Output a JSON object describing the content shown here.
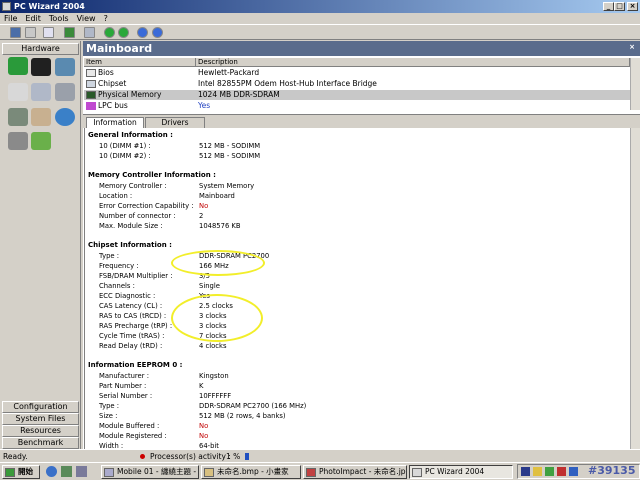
{
  "window": {
    "title": "PC Wizard 2004"
  },
  "menu": [
    "File",
    "Edit",
    "Tools",
    "View",
    "?"
  ],
  "sidebar": {
    "hardware_label": "Hardware",
    "bottom_items": [
      "Configuration",
      "System Files",
      "Resources",
      "Benchmark"
    ]
  },
  "mainboard": {
    "header": "Mainboard",
    "columns": [
      "Item",
      "Description"
    ],
    "rows": [
      {
        "item": "Bios",
        "desc": "Hewlett-Packard"
      },
      {
        "item": "Chipset",
        "desc": "Intel 82855PM Odem Host-Hub Interface Bridge"
      },
      {
        "item": "Physical Memory",
        "desc": "1024 MB DDR-SDRAM"
      },
      {
        "item": "LPC bus",
        "desc": "Yes"
      }
    ]
  },
  "tabs": [
    "Information",
    "Drivers"
  ],
  "info": {
    "general_title": "General Information :",
    "general": [
      {
        "l": "10 (DIMM #1) :",
        "v": "512 MB - SODIMM"
      },
      {
        "l": "10 (DIMM #2) :",
        "v": "512 MB - SODIMM"
      }
    ],
    "memctrl_title": "Memory Controller Information :",
    "memctrl": [
      {
        "l": "Memory Controller :",
        "v": "System Memory"
      },
      {
        "l": "Location :",
        "v": "Mainboard"
      },
      {
        "l": "Error Correction Capability :",
        "v": "No",
        "red": true
      },
      {
        "l": "Number of connector :",
        "v": "2"
      },
      {
        "l": "Max. Module Size :",
        "v": "1048576  KB"
      }
    ],
    "chipset_title": "Chipset Information :",
    "chipset": [
      {
        "l": "Type :",
        "v": "DDR-SDRAM PC2700"
      },
      {
        "l": "Frequency :",
        "v": "166 MHz"
      },
      {
        "l": "FSB/DRAM Multiplier :",
        "v": "3/5"
      },
      {
        "l": "Channels :",
        "v": "Single"
      },
      {
        "l": "ECC Diagnostic :",
        "v": "Yes"
      },
      {
        "l": "CAS Latency (CL) :",
        "v": "2.5 clocks"
      },
      {
        "l": "RAS to CAS (tRCD) :",
        "v": "3 clocks"
      },
      {
        "l": "RAS Precharge (tRP) :",
        "v": "3 clocks"
      },
      {
        "l": "Cycle Time (tRAS) :",
        "v": "7 clocks"
      },
      {
        "l": "Read Delay (tRD) :",
        "v": "4 clocks"
      }
    ],
    "eeprom_title": "Information EEPROM 0 :",
    "eeprom": [
      {
        "l": "Manufacturer :",
        "v": "Kingston"
      },
      {
        "l": "Part Number :",
        "v": "K"
      },
      {
        "l": "Serial Number :",
        "v": "10FFFFFF"
      },
      {
        "l": "Type :",
        "v": "DDR-SDRAM PC2700 (166 MHz)"
      },
      {
        "l": "Size :",
        "v": "512 MB (2 rows, 4 banks)"
      },
      {
        "l": "Module Buffered :",
        "v": "No",
        "red": true
      },
      {
        "l": "Module Registered :",
        "v": "No",
        "red": true
      },
      {
        "l": "Width :",
        "v": "64-bit"
      }
    ]
  },
  "status": {
    "ready": "Ready.",
    "activity": "Processor(s) activity :",
    "percent": "1 %"
  },
  "taskbar": {
    "start": "開始",
    "tasks": [
      "Mobile 01 - 纏繞主題 - ...",
      "未命名.bmp - 小畫家",
      "PhotoImpact - 未命名.jpg",
      "PC Wizard 2004"
    ],
    "watermark": "#39135"
  },
  "colors": {
    "title": "#0a246a",
    "header": "#5a6c8c",
    "highlight": "#f2ee2a",
    "red": "#c00000"
  }
}
